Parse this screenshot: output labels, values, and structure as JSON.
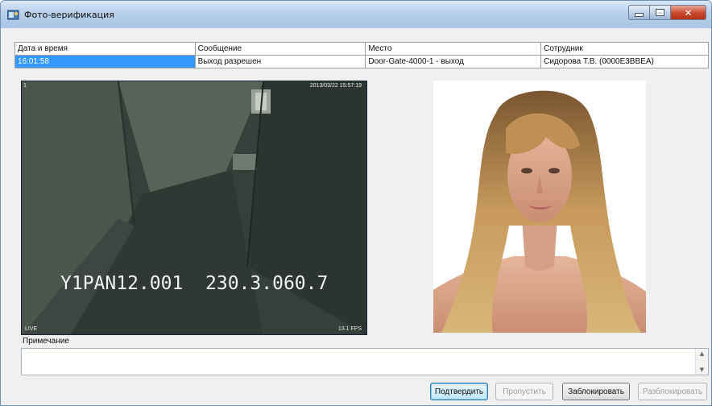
{
  "window": {
    "title": "Фото-верификация"
  },
  "grid": {
    "headers": [
      "Дата и время",
      "Сообщение",
      "Место",
      "Сотрудник"
    ],
    "row": {
      "time": "16:01:58",
      "message": "Выход разрешен",
      "place": "Door-Gate-4000-1 - выход",
      "employee": "Сидорова Т.В. (0000E3BBEA)"
    }
  },
  "camera": {
    "channel": "1",
    "timestamp": "2013/03/22 15:57:19",
    "live_label": "LIVE",
    "fps_label": "13.1 FPS",
    "osd_text": "Y1PAN12.001  230.3.060.7"
  },
  "note": {
    "label": "Примечание",
    "value": ""
  },
  "buttons": {
    "confirm": "Подтвердить",
    "skip": "Пропустить",
    "block": "Заблокировать",
    "unblock": "Разблокировать"
  },
  "colors": {
    "selection": "#3399ff",
    "titlebar": "#b8d0ea",
    "close": "#c8472d"
  }
}
